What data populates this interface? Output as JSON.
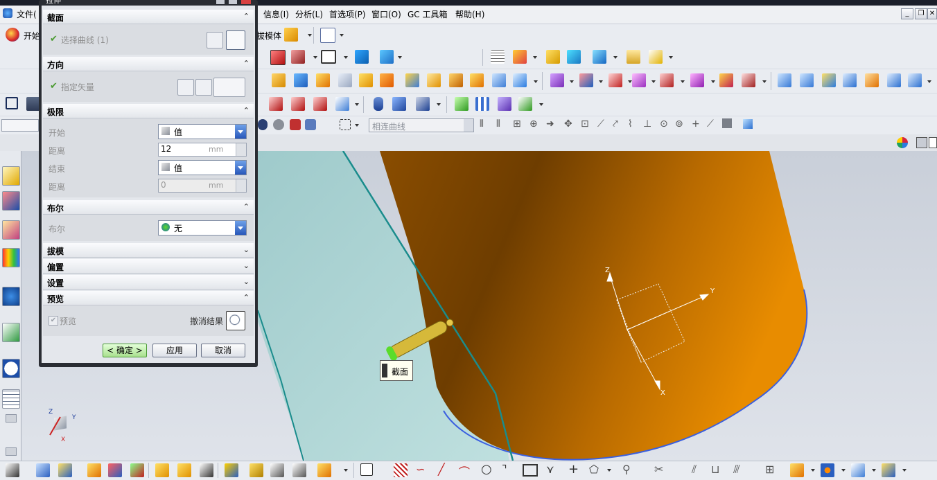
{
  "menubar": {
    "file": "文件(",
    "items": [
      "信息(I)",
      "分析(L)",
      "首选项(P)",
      "窗口(O)",
      "GC 工具箱",
      "帮助(H)"
    ]
  },
  "toolbar": {
    "start": "开始",
    "draft_body": "拔模体",
    "curve_filter": "相连曲线"
  },
  "dialog": {
    "title": "拉伸",
    "sections": {
      "section": "截面",
      "direction": "方向",
      "limits": "极限",
      "boolean": "布尔",
      "draft": "拔模",
      "offset": "偏置",
      "settings": "设置",
      "preview": "预览"
    },
    "select_curve": "选择曲线 (1)",
    "specify_vector": "指定矢量",
    "start_label": "开始",
    "start_value": "值",
    "distance_label": "距离",
    "start_distance": "12",
    "unit": "mm",
    "end_label": "结束",
    "end_value": "值",
    "end_distance": "0",
    "boolean_label": "布尔",
    "boolean_value": "无",
    "preview_label": "预览",
    "undo_result": "撤消结果",
    "ok": "< 确定 >",
    "apply": "应用",
    "cancel": "取消"
  },
  "viewport": {
    "tooltip": "截面",
    "csys_labels": {
      "z": "Z",
      "y": "Y",
      "x": "X"
    },
    "triad_labels": {
      "z": "Z",
      "y": "Y",
      "x": "X"
    }
  },
  "colors": {
    "body_orange": "#e08a00",
    "sheet_cyan": "#a9d2d2",
    "accent_blue": "#2f5fc0",
    "ok_green": "#a8e08e"
  }
}
